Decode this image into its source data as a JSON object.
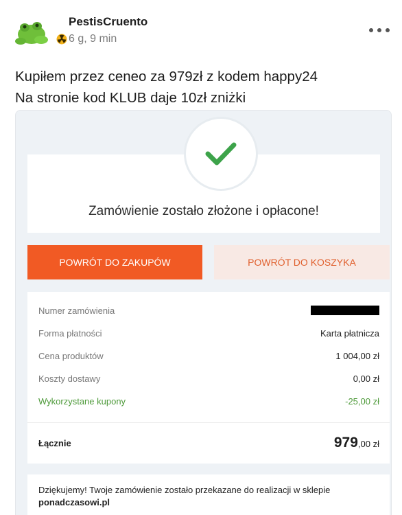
{
  "post": {
    "username": "PestisCruento",
    "timestamp": "6 g, 9 min",
    "text_line1": "Kupiłem przez ceneo za 979zł z kodem happy24",
    "text_line2": "Na stronie kod KLUB daje 10zł zniżki",
    "avatar_icon": "green-frog-avatar-icon",
    "badge_icon": "radiation-badge-icon",
    "more_icon": "more-dots-icon"
  },
  "order": {
    "success_title": "Zamówienie zostało złożone i opłacone!",
    "primary_button": "POWRÓT DO ZAKUPÓW",
    "secondary_button": "POWRÓT DO KOSZYKA",
    "rows": [
      {
        "label": "Numer zamówienia",
        "value": ""
      },
      {
        "label": "Forma płatności",
        "value": "Karta płatnicza"
      },
      {
        "label": "Cena produktów",
        "value": "1 004,00 zł"
      },
      {
        "label": "Koszty dostawy",
        "value": "0,00 zł"
      },
      {
        "label": "Wykorzystane kupony",
        "value": "-25,00 zł"
      }
    ],
    "total_label": "Łącznie",
    "total_int": "979",
    "total_dec": ",00 zł",
    "thanks_text": "Dziękujemy! Twoje zamówienie zostało przekazane do realizacji w sklepie",
    "shop_name": "ponadczasowi.pl"
  },
  "colors": {
    "accent": "#f15a24",
    "secondary_bg": "#f8e9e4",
    "check_green": "#3da34a",
    "coupon_green": "#4e9a3a"
  }
}
